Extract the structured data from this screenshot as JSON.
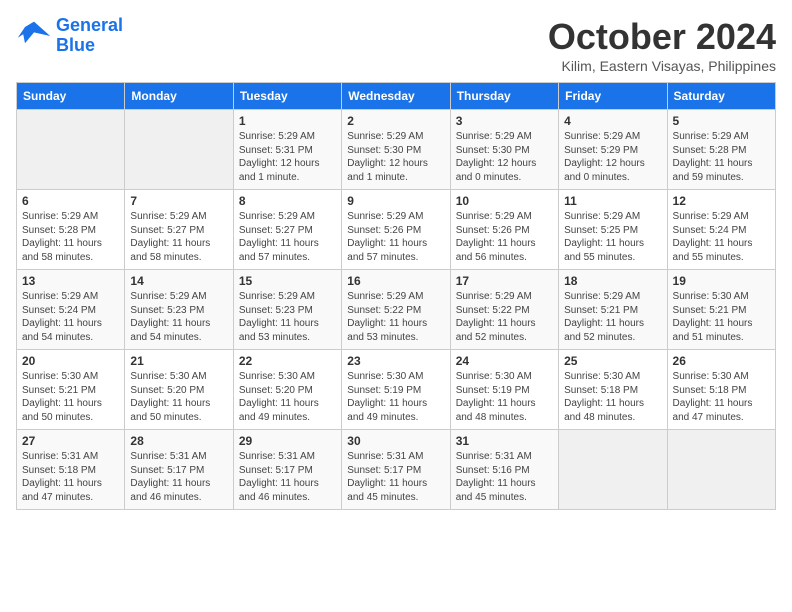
{
  "header": {
    "logo_line1": "General",
    "logo_line2": "Blue",
    "month": "October 2024",
    "location": "Kilim, Eastern Visayas, Philippines"
  },
  "days_of_week": [
    "Sunday",
    "Monday",
    "Tuesday",
    "Wednesday",
    "Thursday",
    "Friday",
    "Saturday"
  ],
  "weeks": [
    [
      {
        "day": "",
        "content": ""
      },
      {
        "day": "",
        "content": ""
      },
      {
        "day": "1",
        "content": "Sunrise: 5:29 AM\nSunset: 5:31 PM\nDaylight: 12 hours\nand 1 minute."
      },
      {
        "day": "2",
        "content": "Sunrise: 5:29 AM\nSunset: 5:30 PM\nDaylight: 12 hours\nand 1 minute."
      },
      {
        "day": "3",
        "content": "Sunrise: 5:29 AM\nSunset: 5:30 PM\nDaylight: 12 hours\nand 0 minutes."
      },
      {
        "day": "4",
        "content": "Sunrise: 5:29 AM\nSunset: 5:29 PM\nDaylight: 12 hours\nand 0 minutes."
      },
      {
        "day": "5",
        "content": "Sunrise: 5:29 AM\nSunset: 5:28 PM\nDaylight: 11 hours\nand 59 minutes."
      }
    ],
    [
      {
        "day": "6",
        "content": "Sunrise: 5:29 AM\nSunset: 5:28 PM\nDaylight: 11 hours\nand 58 minutes."
      },
      {
        "day": "7",
        "content": "Sunrise: 5:29 AM\nSunset: 5:27 PM\nDaylight: 11 hours\nand 58 minutes."
      },
      {
        "day": "8",
        "content": "Sunrise: 5:29 AM\nSunset: 5:27 PM\nDaylight: 11 hours\nand 57 minutes."
      },
      {
        "day": "9",
        "content": "Sunrise: 5:29 AM\nSunset: 5:26 PM\nDaylight: 11 hours\nand 57 minutes."
      },
      {
        "day": "10",
        "content": "Sunrise: 5:29 AM\nSunset: 5:26 PM\nDaylight: 11 hours\nand 56 minutes."
      },
      {
        "day": "11",
        "content": "Sunrise: 5:29 AM\nSunset: 5:25 PM\nDaylight: 11 hours\nand 55 minutes."
      },
      {
        "day": "12",
        "content": "Sunrise: 5:29 AM\nSunset: 5:24 PM\nDaylight: 11 hours\nand 55 minutes."
      }
    ],
    [
      {
        "day": "13",
        "content": "Sunrise: 5:29 AM\nSunset: 5:24 PM\nDaylight: 11 hours\nand 54 minutes."
      },
      {
        "day": "14",
        "content": "Sunrise: 5:29 AM\nSunset: 5:23 PM\nDaylight: 11 hours\nand 54 minutes."
      },
      {
        "day": "15",
        "content": "Sunrise: 5:29 AM\nSunset: 5:23 PM\nDaylight: 11 hours\nand 53 minutes."
      },
      {
        "day": "16",
        "content": "Sunrise: 5:29 AM\nSunset: 5:22 PM\nDaylight: 11 hours\nand 53 minutes."
      },
      {
        "day": "17",
        "content": "Sunrise: 5:29 AM\nSunset: 5:22 PM\nDaylight: 11 hours\nand 52 minutes."
      },
      {
        "day": "18",
        "content": "Sunrise: 5:29 AM\nSunset: 5:21 PM\nDaylight: 11 hours\nand 52 minutes."
      },
      {
        "day": "19",
        "content": "Sunrise: 5:30 AM\nSunset: 5:21 PM\nDaylight: 11 hours\nand 51 minutes."
      }
    ],
    [
      {
        "day": "20",
        "content": "Sunrise: 5:30 AM\nSunset: 5:21 PM\nDaylight: 11 hours\nand 50 minutes."
      },
      {
        "day": "21",
        "content": "Sunrise: 5:30 AM\nSunset: 5:20 PM\nDaylight: 11 hours\nand 50 minutes."
      },
      {
        "day": "22",
        "content": "Sunrise: 5:30 AM\nSunset: 5:20 PM\nDaylight: 11 hours\nand 49 minutes."
      },
      {
        "day": "23",
        "content": "Sunrise: 5:30 AM\nSunset: 5:19 PM\nDaylight: 11 hours\nand 49 minutes."
      },
      {
        "day": "24",
        "content": "Sunrise: 5:30 AM\nSunset: 5:19 PM\nDaylight: 11 hours\nand 48 minutes."
      },
      {
        "day": "25",
        "content": "Sunrise: 5:30 AM\nSunset: 5:18 PM\nDaylight: 11 hours\nand 48 minutes."
      },
      {
        "day": "26",
        "content": "Sunrise: 5:30 AM\nSunset: 5:18 PM\nDaylight: 11 hours\nand 47 minutes."
      }
    ],
    [
      {
        "day": "27",
        "content": "Sunrise: 5:31 AM\nSunset: 5:18 PM\nDaylight: 11 hours\nand 47 minutes."
      },
      {
        "day": "28",
        "content": "Sunrise: 5:31 AM\nSunset: 5:17 PM\nDaylight: 11 hours\nand 46 minutes."
      },
      {
        "day": "29",
        "content": "Sunrise: 5:31 AM\nSunset: 5:17 PM\nDaylight: 11 hours\nand 46 minutes."
      },
      {
        "day": "30",
        "content": "Sunrise: 5:31 AM\nSunset: 5:17 PM\nDaylight: 11 hours\nand 45 minutes."
      },
      {
        "day": "31",
        "content": "Sunrise: 5:31 AM\nSunset: 5:16 PM\nDaylight: 11 hours\nand 45 minutes."
      },
      {
        "day": "",
        "content": ""
      },
      {
        "day": "",
        "content": ""
      }
    ]
  ]
}
